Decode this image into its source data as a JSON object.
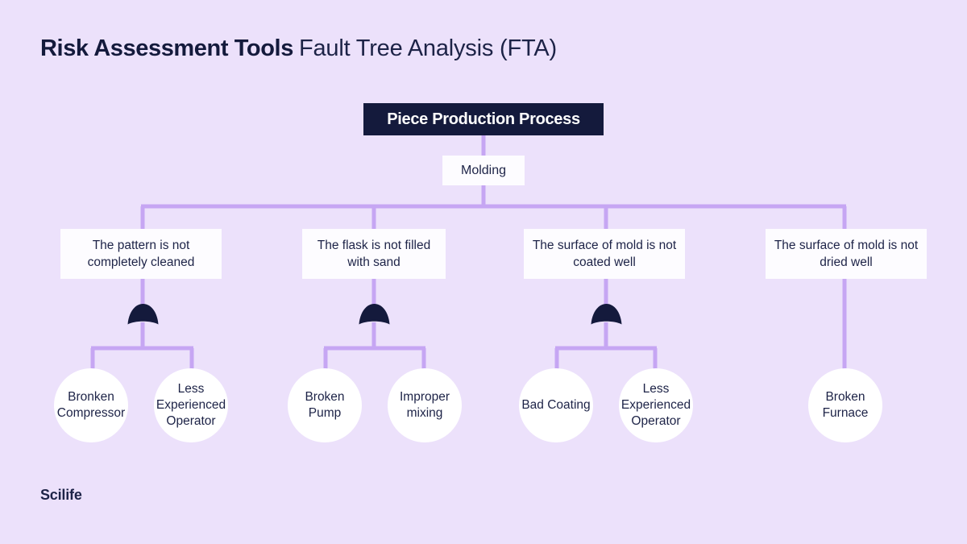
{
  "header": {
    "title_bold": "Risk Assessment Tools",
    "title_light": "Fault Tree Analysis (FTA)"
  },
  "colors": {
    "background": "#ece1fb",
    "connector": "#c6a6f3",
    "node_dark": "#141a3c",
    "node_light": "#fdfcff",
    "text_dark": "#1d2347"
  },
  "diagram": {
    "root": {
      "label": "Piece Production Process"
    },
    "subroot": {
      "label": "Molding"
    },
    "branches": [
      {
        "label": "The pattern is not completely cleaned",
        "gate": "and-gate",
        "causes": [
          {
            "label": "Bronken Compressor"
          },
          {
            "label": "Less Experienced Operator"
          }
        ]
      },
      {
        "label": "The flask is not filled with sand",
        "gate": "and-gate",
        "causes": [
          {
            "label": "Broken Pump"
          },
          {
            "label": "Improper mixing"
          }
        ]
      },
      {
        "label": "The surface of mold is not coated well",
        "gate": "and-gate",
        "causes": [
          {
            "label": "Bad Coating"
          },
          {
            "label": "Less Experienced Operator"
          }
        ]
      },
      {
        "label": "The surface of mold is not dried well",
        "gate": "none",
        "causes": [
          {
            "label": "Broken Furnace"
          }
        ]
      }
    ]
  },
  "footer": {
    "logo": "Scilife"
  }
}
